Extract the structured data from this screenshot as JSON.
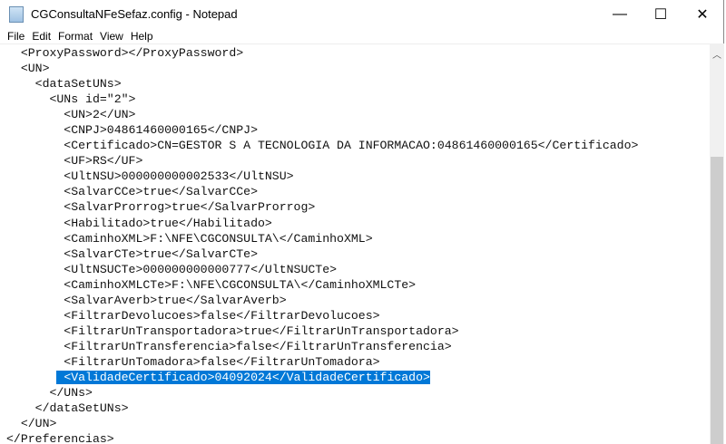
{
  "window": {
    "title": "CGConsultaNFeSefaz.config - Notepad",
    "minimize": "—",
    "maximize": "☐",
    "close": "✕"
  },
  "menu": [
    "File",
    "Edit",
    "Format",
    "View",
    "Help"
  ],
  "lines": [
    "  <ProxyPassword></ProxyPassword>",
    "  <UN>",
    "    <dataSetUNs>",
    "      <UNs id=\"2\">",
    "        <UN>2</UN>",
    "        <CNPJ>04861460000165</CNPJ>",
    "        <Certificado>CN=GESTOR S A TECNOLOGIA DA INFORMACAO:04861460000165</Certificado>",
    "        <UF>RS</UF>",
    "        <UltNSU>000000000002533</UltNSU>",
    "        <SalvarCCe>true</SalvarCCe>",
    "        <SalvarProrrog>true</SalvarProrrog>",
    "        <Habilitado>true</Habilitado>",
    "        <CaminhoXML>F:\\NFE\\CGCONSULTA\\</CaminhoXML>",
    "        <SalvarCTe>true</SalvarCTe>",
    "        <UltNSUCTe>000000000000777</UltNSUCTe>",
    "        <CaminhoXMLCTe>F:\\NFE\\CGCONSULTA\\</CaminhoXMLCTe>",
    "        <SalvarAverb>true</SalvarAverb>",
    "        <FiltrarDevolucoes>false</FiltrarDevolucoes>",
    "        <FiltrarUnTransportadora>true</FiltrarUnTransportadora>",
    "        <FiltrarUnTransferencia>false</FiltrarUnTransferencia>",
    "        <FiltrarUnTomadora>false</FiltrarUnTomadora>"
  ],
  "selected_indent": "       ",
  "selected_line": " <ValidadeCertificado>04092024</ValidadeCertificado>",
  "after_lines": [
    "      </UNs>",
    "    </dataSetUNs>",
    "  </UN>",
    "</Preferencias>"
  ]
}
